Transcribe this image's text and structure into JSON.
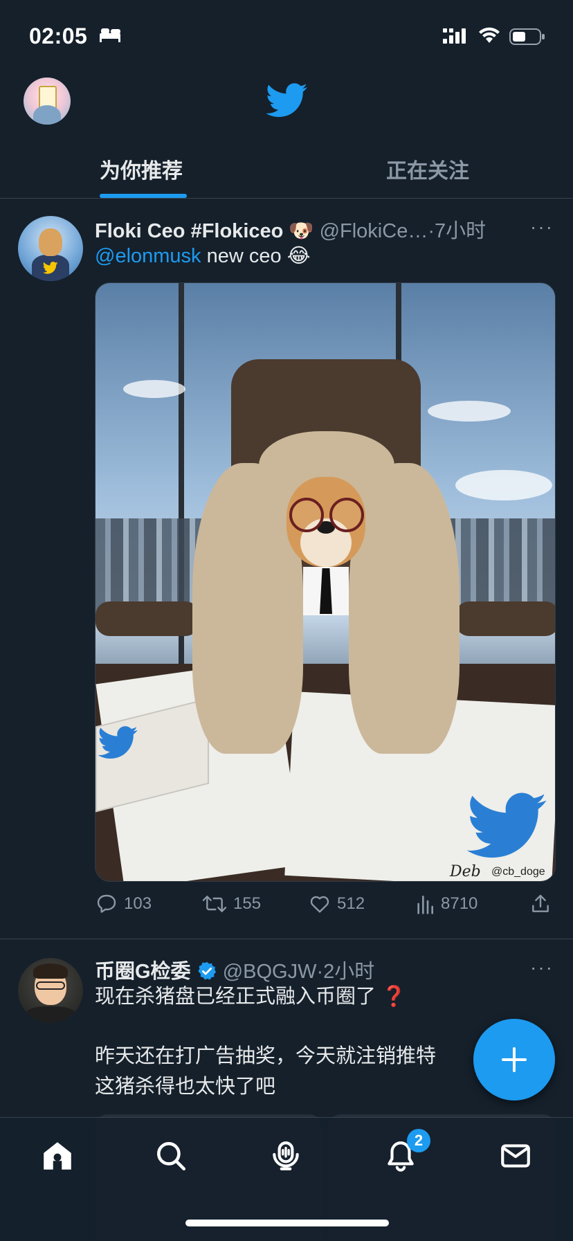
{
  "status_bar": {
    "time": "02:05"
  },
  "tabs": [
    {
      "label": "为你推荐",
      "active": true
    },
    {
      "label": "正在关注",
      "active": false
    }
  ],
  "tweets": [
    {
      "display_name": "Floki Ceo #Flokiceo",
      "name_emoji": "🐶",
      "handle": "@FlokiCe…",
      "time": "·7小时",
      "more": "···",
      "mention": "@elonmusk",
      "text": " new ceo ",
      "text_emoji": "😂",
      "media": {
        "signature": "Deb",
        "watermark": "@cb_doge"
      },
      "stats": {
        "replies": "103",
        "retweets": "155",
        "likes": "512",
        "views": "8710"
      }
    },
    {
      "display_name": "币圈G检委",
      "verified": true,
      "handle": "@BQGJW",
      "time": "·2小时",
      "more": "···",
      "line1": "现在杀猪盘已经正式融入币圈了",
      "line1_emoji": "❓",
      "line2": "昨天还在打广告抽奖，今天就注销推特",
      "line3": "这猪杀得也太快了吧"
    }
  ],
  "bottom_nav": {
    "items": [
      "home-icon",
      "search-icon",
      "spaces-icon",
      "notifications-icon",
      "messages-icon"
    ],
    "notification_badge": "2"
  },
  "colors": {
    "background": "#15202b",
    "accent": "#1d9bf0",
    "muted": "#8b98a5",
    "text": "#e7e9ea"
  }
}
